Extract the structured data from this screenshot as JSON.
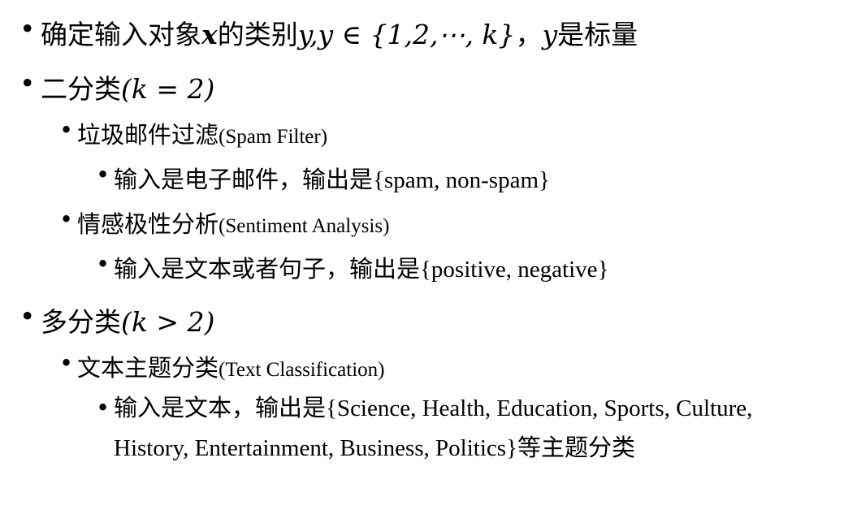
{
  "bullet": "•",
  "line1": {
    "zh_a": "确定输入对象",
    "x": "x",
    "zh_b": "的类别",
    "math": "y,y ∈ {1,2,⋯, k}",
    "sep": "，",
    "y": "y",
    "zh_c": "是标量"
  },
  "binary": {
    "zh": "二分类",
    "math": "(k = 2)",
    "spam": {
      "zh": "垃圾邮件过滤",
      "en": "(Spam Filter)",
      "detail_zh": "输入是电子邮件，输出是",
      "detail_en": "{spam, non-spam}"
    },
    "sentiment": {
      "zh": "情感极性分析",
      "en": "(Sentiment Analysis)",
      "detail_zh": "输入是文本或者句子，输出是",
      "detail_en": "{positive, negative}"
    }
  },
  "multi": {
    "zh": "多分类",
    "math": "(k > 2)",
    "topic": {
      "zh": "文本主题分类",
      "en": "(Text Classification)",
      "detail_zh": "输入是文本，输出是",
      "detail_en": "{Science, Health, Education, Sports, Culture, History, Entertainment,  Business, Politics}",
      "detail_tail": "等主题分类"
    }
  }
}
